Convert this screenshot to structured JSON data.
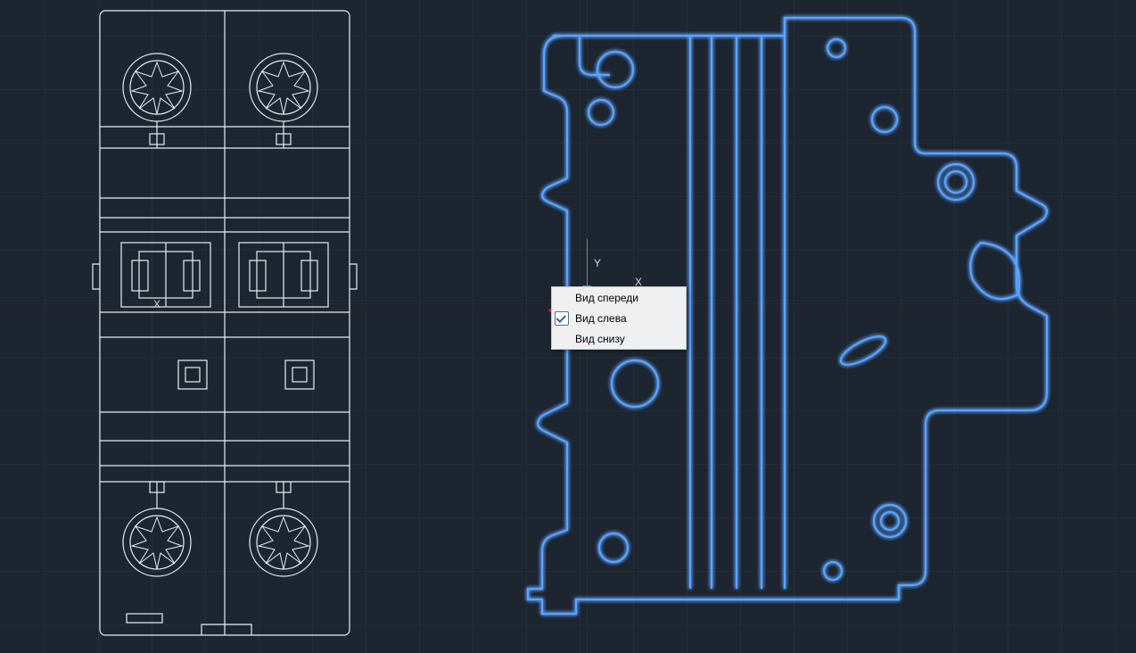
{
  "ucs": {
    "x_label": "X",
    "y_label": "Y",
    "left_view_x_label": "X"
  },
  "context_menu": {
    "items": [
      {
        "label": "Вид спереди",
        "checked": false
      },
      {
        "label": "Вид слева",
        "checked": true
      },
      {
        "label": "Вид снизу",
        "checked": false
      }
    ]
  },
  "colors": {
    "background": "#1d2530",
    "grid": "#242d3a",
    "white_stroke": "#e6eef5",
    "blue_glow": "#3c84ff",
    "axis_red": "#c62828",
    "axis_green": "#5f9e6a",
    "hub_blue": "#3596ff"
  },
  "icons": {
    "ucs_arrow": "ucs-origin-arrow"
  }
}
